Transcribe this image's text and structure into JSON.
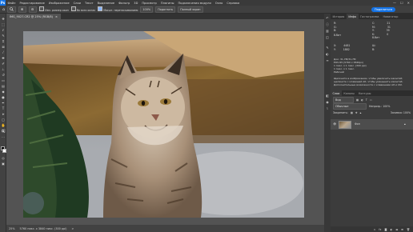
{
  "menubar": {
    "logo": "Ps",
    "items": [
      "Файл",
      "Редактирование",
      "Изображение",
      "Слои",
      "Текст",
      "Выделение",
      "Фильтр",
      "3D",
      "Просмотр",
      "Плагины",
      "Подключения модули",
      "Окно",
      "Справка"
    ],
    "window_controls": [
      "—",
      "☐",
      "✕"
    ]
  },
  "optionsbar": {
    "tool_icon": "zoom-icon",
    "resize_label": "Изм. размер окон",
    "all_windows_label": "Во всех окнах",
    "scrubby_label": "Масшт. перетаскиванием",
    "zoom_value": "100%",
    "fit_label": "Подогнать",
    "fill_label": "Полный экран",
    "share_label": "Поделиться"
  },
  "document": {
    "tab_title": "IMG_9027.CR2 @ 25% (RGB/8)",
    "close_glyph": "×"
  },
  "statusbar": {
    "zoom": "25%",
    "size": "5760 пикс. x 3840 пикс. (300 ppi)",
    "arrow": ">"
  },
  "panels": {
    "top_tabs": [
      "История",
      "Инфо",
      "Гистограмма",
      "Навигатор"
    ],
    "info": {
      "r_label": "R:",
      "g_label": "G:",
      "b_label": "B:",
      "c_label": "C:",
      "m_label": "M:",
      "y_label": "Y:",
      "k_label": "K:",
      "c_val": "21",
      "m_val": "31",
      "y_val": "39",
      "k_val": "0",
      "bit_label": "8-бит",
      "bit_label2": "8-бит",
      "x_label": "X:",
      "y2_label": "Y:",
      "x_val": "4481",
      "y_val2": "1882",
      "w_label": "Ш:",
      "h_label": "В:",
      "file_line1": "Док: 31,7M/31,7M",
      "file_line2": "EOS R5 (5760 x 3840px)",
      "file_line3": "1 пикс. x 1 пикс. (300 ppi)",
      "file_line4": "1 пикс. x 1 пикс.",
      "file_line5": "Рабочий",
      "hint_line1": "Щелкните в изображении, чтобы увеличить масштаб;",
      "hint_line2": "щелкните с клавишей Alt, чтобы уменьшить масштаб.",
      "hint_line3": "Дополнительные возможности с клавишами Alt и Ctrl."
    },
    "layer_tabs": [
      "Слои",
      "Каналы",
      "Контуры"
    ],
    "layer_filter_label": "Вид",
    "blend_mode": "Обычные",
    "opacity_label": "Непрозр.: 100%",
    "fill_label": "Заливка: 100%",
    "lock_label": "Закрепить:",
    "layer_name": "Фон",
    "layer_lock_icon": "lock-icon",
    "bottom_icons": [
      "link-icon",
      "fx-icon",
      "mask-icon",
      "adjust-icon",
      "folder-icon",
      "new-layer-icon",
      "trash-icon"
    ]
  },
  "toolbar_icons": [
    "move-icon",
    "marquee-icon",
    "lasso-icon",
    "quick-select-icon",
    "crop-icon",
    "frame-icon",
    "eyedropper-icon",
    "healing-icon",
    "brush-icon",
    "stamp-icon",
    "history-brush-icon",
    "eraser-icon",
    "gradient-icon",
    "blur-icon",
    "dodge-icon",
    "pen-icon",
    "type-icon",
    "path-select-icon",
    "shape-icon",
    "hand-icon",
    "zoom-icon",
    "more-icon"
  ],
  "side_icons": [
    "history-icon",
    "info-icon",
    "histogram-icon",
    "navigator-icon",
    "brush-panel-icon",
    "adjustments-icon",
    "properties-icon",
    "layers-icon",
    "channels-icon",
    "paths-icon"
  ]
}
